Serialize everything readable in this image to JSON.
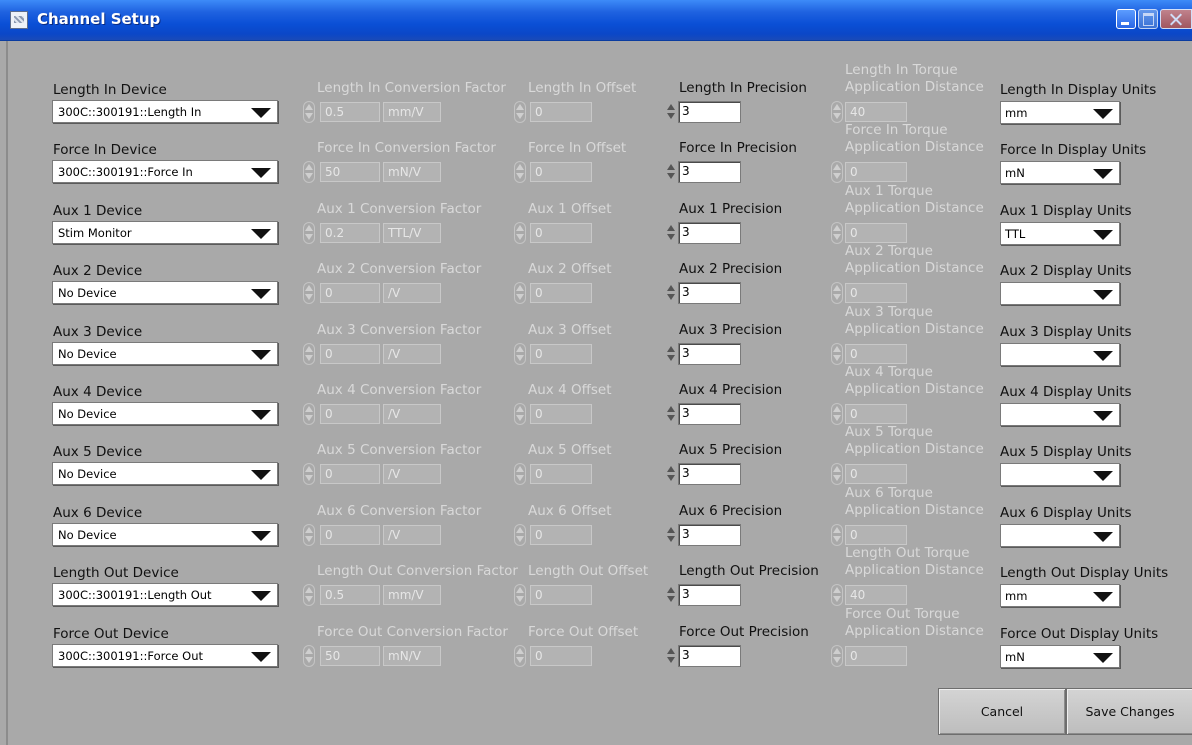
{
  "window": {
    "title": "Channel Setup"
  },
  "channels": [
    {
      "device_label": "Length In Device",
      "device_value": "300C::300191::Length In",
      "cf_label": "Length In Conversion Factor",
      "cf_value": "0.5",
      "cf_unit": "mm/V",
      "offset_label": "Length In Offset",
      "offset_value": "0",
      "precision_label": "Length In Precision",
      "precision_value": "3",
      "torque_line1": "Length In Torque",
      "torque_line2": "Application Distance",
      "torque_value": "40",
      "units_label": "Length In Display Units",
      "units_value": "mm"
    },
    {
      "device_label": "Force In Device",
      "device_value": "300C::300191::Force In",
      "cf_label": "Force In Conversion Factor",
      "cf_value": "50",
      "cf_unit": "mN/V",
      "offset_label": "Force In Offset",
      "offset_value": "0",
      "precision_label": "Force In Precision",
      "precision_value": "3",
      "torque_line1": "Force In Torque",
      "torque_line2": "Application Distance",
      "torque_value": "0",
      "units_label": "Force In Display Units",
      "units_value": "mN"
    },
    {
      "device_label": "Aux 1 Device",
      "device_value": "Stim Monitor",
      "cf_label": "Aux 1 Conversion Factor",
      "cf_value": "0.2",
      "cf_unit": "TTL/V",
      "offset_label": "Aux 1 Offset",
      "offset_value": "0",
      "precision_label": "Aux 1 Precision",
      "precision_value": "3",
      "torque_line1": "Aux 1 Torque",
      "torque_line2": "Application Distance",
      "torque_value": "0",
      "units_label": "Aux 1 Display Units",
      "units_value": "TTL"
    },
    {
      "device_label": "Aux 2 Device",
      "device_value": "No Device",
      "cf_label": "Aux 2 Conversion Factor",
      "cf_value": "0",
      "cf_unit": "/V",
      "offset_label": "Aux 2 Offset",
      "offset_value": "0",
      "precision_label": "Aux 2 Precision",
      "precision_value": "3",
      "torque_line1": "Aux 2 Torque",
      "torque_line2": "Application Distance",
      "torque_value": "0",
      "units_label": "Aux 2 Display Units",
      "units_value": ""
    },
    {
      "device_label": "Aux 3 Device",
      "device_value": "No Device",
      "cf_label": "Aux 3 Conversion Factor",
      "cf_value": "0",
      "cf_unit": "/V",
      "offset_label": "Aux 3 Offset",
      "offset_value": "0",
      "precision_label": "Aux 3 Precision",
      "precision_value": "3",
      "torque_line1": "Aux 3 Torque",
      "torque_line2": "Application Distance",
      "torque_value": "0",
      "units_label": "Aux 3 Display Units",
      "units_value": ""
    },
    {
      "device_label": "Aux 4 Device",
      "device_value": "No Device",
      "cf_label": "Aux 4 Conversion Factor",
      "cf_value": "0",
      "cf_unit": "/V",
      "offset_label": "Aux 4 Offset",
      "offset_value": "0",
      "precision_label": "Aux 4 Precision",
      "precision_value": "3",
      "torque_line1": "Aux 4 Torque",
      "torque_line2": "Application Distance",
      "torque_value": "0",
      "units_label": "Aux 4 Display Units",
      "units_value": ""
    },
    {
      "device_label": "Aux 5 Device",
      "device_value": "No Device",
      "cf_label": "Aux 5 Conversion Factor",
      "cf_value": "0",
      "cf_unit": "/V",
      "offset_label": "Aux 5 Offset",
      "offset_value": "0",
      "precision_label": "Aux 5 Precision",
      "precision_value": "3",
      "torque_line1": "Aux 5 Torque",
      "torque_line2": "Application Distance",
      "torque_value": "0",
      "units_label": "Aux 5 Display Units",
      "units_value": ""
    },
    {
      "device_label": "Aux 6 Device",
      "device_value": "No Device",
      "cf_label": "Aux 6 Conversion Factor",
      "cf_value": "0",
      "cf_unit": "/V",
      "offset_label": "Aux 6 Offset",
      "offset_value": "0",
      "precision_label": "Aux 6 Precision",
      "precision_value": "3",
      "torque_line1": "Aux 6 Torque",
      "torque_line2": "Application Distance",
      "torque_value": "0",
      "units_label": "Aux 6 Display Units",
      "units_value": ""
    },
    {
      "device_label": "Length Out Device",
      "device_value": "300C::300191::Length Out",
      "cf_label": "Length Out Conversion Factor",
      "cf_value": "0.5",
      "cf_unit": "mm/V",
      "offset_label": "Length Out Offset",
      "offset_value": "0",
      "precision_label": "Length Out Precision",
      "precision_value": "3",
      "torque_line1": "Length Out Torque",
      "torque_line2": "Application Distance",
      "torque_value": "40",
      "units_label": "Length Out Display Units",
      "units_value": "mm"
    },
    {
      "device_label": "Force Out Device",
      "device_value": "300C::300191::Force Out",
      "cf_label": "Force Out Conversion Factor",
      "cf_value": "50",
      "cf_unit": "mN/V",
      "offset_label": "Force Out Offset",
      "offset_value": "0",
      "precision_label": "Force Out Precision",
      "precision_value": "3",
      "torque_line1": "Force Out Torque",
      "torque_line2": "Application Distance",
      "torque_value": "0",
      "units_label": "Force Out Display Units",
      "units_value": "mN"
    }
  ],
  "buttons": {
    "cancel": "Cancel",
    "save": "Save Changes"
  },
  "colors": {
    "titlebar": "#0a4fd6",
    "background": "#a9a9a9",
    "disabled_text": "#d9d9d9"
  }
}
